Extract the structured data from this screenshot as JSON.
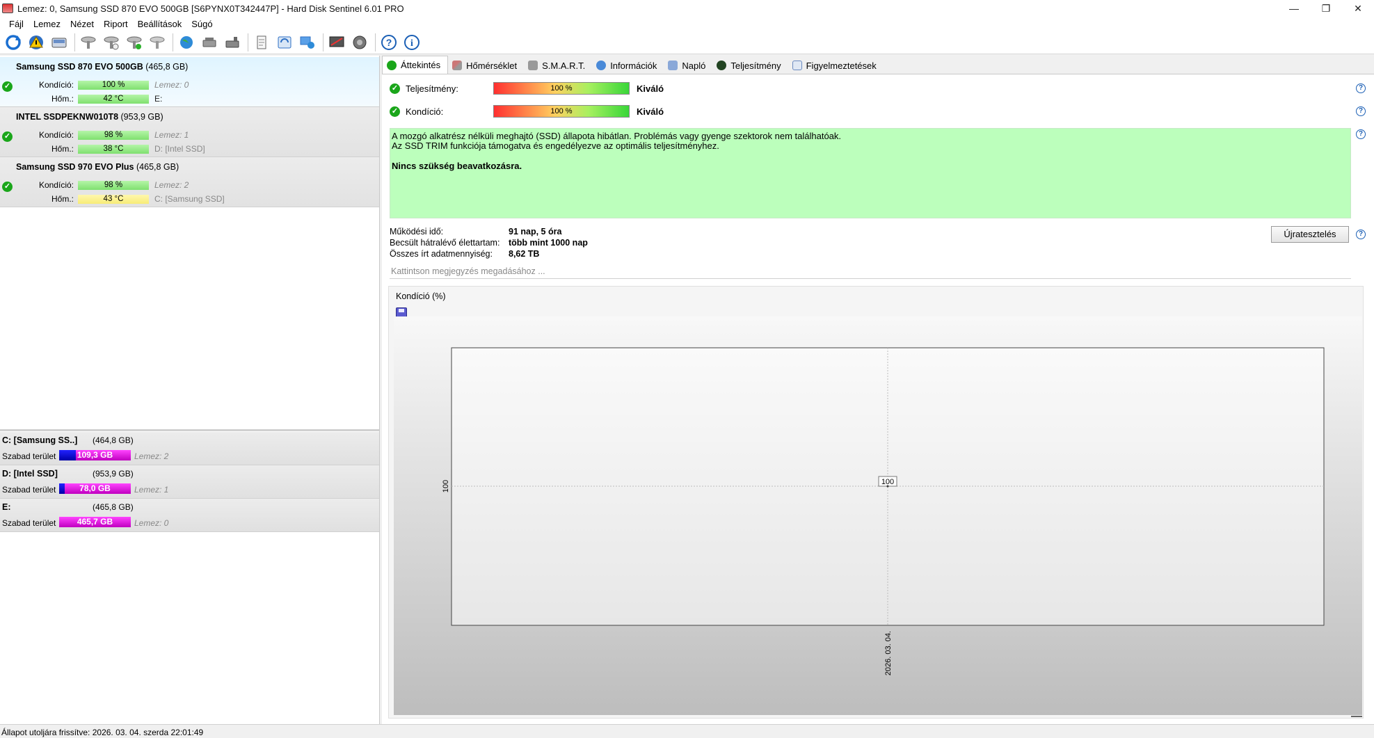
{
  "window": {
    "title": "Lemez: 0, Samsung SSD 870 EVO 500GB [S6PYNX0T342447P]  -  Hard Disk Sentinel 6.01 PRO",
    "minimize": "—",
    "maximize": "❐",
    "close": "✕"
  },
  "menu": [
    "Fájl",
    "Lemez",
    "Nézet",
    "Riport",
    "Beállítások",
    "Súgó"
  ],
  "toolbar_icons": [
    "refresh-icon",
    "alert-icon",
    "disk-icon",
    "probe-icon",
    "probe-test-icon",
    "probe-check-icon",
    "probe-add-icon",
    "globe-icon",
    "drive-icon",
    "drive-alt-icon",
    "report-icon",
    "sync-icon",
    "network-icon",
    "monitor-icon",
    "speaker-icon",
    "help-icon",
    "info-icon"
  ],
  "disks": [
    {
      "name": "Samsung SSD 870 EVO 500GB",
      "size": "(465,8 GB)",
      "cond_label": "Kondíció:",
      "cond": "100 %",
      "temp_label": "Hőm.:",
      "temp": "42 °C",
      "disk_no": "Lemez: 0",
      "drive": "E:"
    },
    {
      "name": "INTEL SSDPEKNW010T8",
      "size": "(953,9 GB)",
      "cond_label": "Kondíció:",
      "cond": "98 %",
      "temp_label": "Hőm.:",
      "temp": "38 °C",
      "disk_no": "Lemez: 1",
      "drive": "D: [Intel SSD]"
    },
    {
      "name": "Samsung SSD 970 EVO Plus",
      "size": "(465,8 GB)",
      "cond_label": "Kondíció:",
      "cond": "98 %",
      "temp_label": "Hőm.:",
      "temp": "43 °C",
      "disk_no": "Lemez: 2",
      "drive": "C: [Samsung SSD]"
    }
  ],
  "volumes": [
    {
      "name": "C: [Samsung SS..]",
      "size": "(464,8 GB)",
      "free_label": "Szabad terület",
      "free": "109,3 GB",
      "free_fraction": 0.235,
      "disk_no": "Lemez: 2"
    },
    {
      "name": "D: [Intel SSD]",
      "size": "(953,9 GB)",
      "free_label": "Szabad terület",
      "free": "78,0 GB",
      "free_fraction": 0.082,
      "disk_no": "Lemez: 1"
    },
    {
      "name": "E:",
      "size": "(465,8 GB)",
      "free_label": "Szabad terület",
      "free": "465,7 GB",
      "free_fraction": 1.0,
      "disk_no": "Lemez: 0"
    }
  ],
  "tabs": [
    "Áttekintés",
    "Hőmérséklet",
    "S.M.A.R.T.",
    "Információk",
    "Napló",
    "Teljesítmény",
    "Figyelmeztetések"
  ],
  "overview": {
    "perf_label": "Teljesítmény:",
    "perf_value": "100 %",
    "perf_rating": "Kiváló",
    "cond_label": "Kondíció:",
    "cond_value": "100 %",
    "cond_rating": "Kiváló",
    "message_line1": "A mozgó alkatrész nélküli meghajtó (SSD) állapota hibátlan. Problémás vagy gyenge szektorok nem találhatóak.",
    "message_line2": "Az SSD TRIM funkciója támogatva és engedélyezve az optimális teljesítményhez.",
    "message_bold": "Nincs szükség beavatkozásra.",
    "uptime_label": "Működési idő:",
    "uptime": "91 nap, 5 óra",
    "lifetime_label": "Becsült hátralévő élettartam:",
    "lifetime": "több mint 1000 nap",
    "written_label": "Összes írt adatmennyiség:",
    "written": "8,62 TB",
    "retest_button": "Újratesztelés",
    "note_placeholder": "Kattintson megjegyzés megadásához ...",
    "help": "?"
  },
  "chart_data": {
    "type": "line",
    "title": "Kondíció  (%)",
    "x": [
      "2026. 03. 04."
    ],
    "series": [
      {
        "values": [
          100
        ]
      }
    ],
    "y_tick": "100",
    "point_label": "100",
    "grid": true
  },
  "status_bar": "Állapot utoljára frissítve: 2026. 03. 04. szerda 22:01:49"
}
